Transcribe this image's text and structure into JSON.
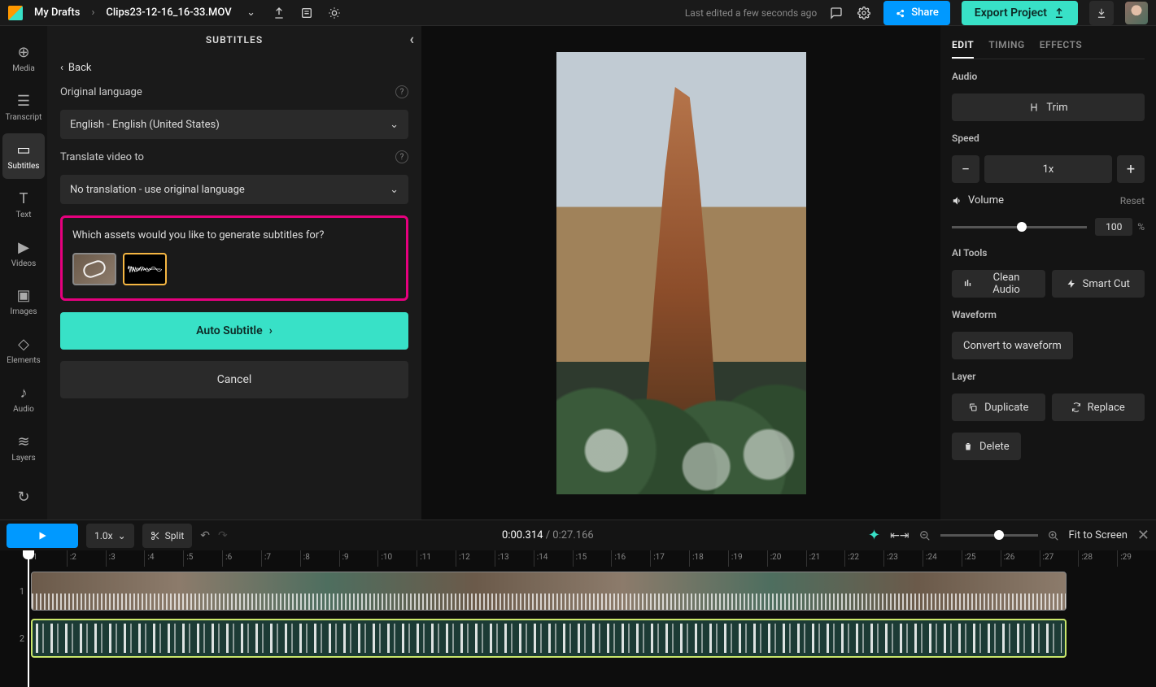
{
  "header": {
    "breadcrumb_root": "My Drafts",
    "breadcrumb_file": "Clips23-12-16_16-33.MOV",
    "status": "Last edited a few seconds ago",
    "share": "Share",
    "export": "Export Project"
  },
  "leftnav": {
    "media": "Media",
    "transcript": "Transcript",
    "subtitles": "Subtitles",
    "text": "Text",
    "videos": "Videos",
    "images": "Images",
    "elements": "Elements",
    "audio": "Audio",
    "layers": "Layers"
  },
  "panel": {
    "title": "SUBTITLES",
    "back": "Back",
    "orig_lang_label": "Original language",
    "orig_lang_value": "English - English (United States)",
    "translate_label": "Translate video to",
    "translate_value": "No translation - use original language",
    "assets_prompt": "Which assets would you like to generate subtitles for?",
    "auto_btn": "Auto Subtitle",
    "cancel_btn": "Cancel"
  },
  "right": {
    "tabs": {
      "edit": "EDIT",
      "timing": "TIMING",
      "effects": "EFFECTS"
    },
    "audio_label": "Audio",
    "trim": "Trim",
    "speed_label": "Speed",
    "speed_value": "1x",
    "volume": "Volume",
    "reset": "Reset",
    "volume_value": "100",
    "volume_unit": "%",
    "ai_label": "AI Tools",
    "clean": "Clean Audio",
    "smart": "Smart Cut",
    "wave_label": "Waveform",
    "convert": "Convert to waveform",
    "layer_label": "Layer",
    "duplicate": "Duplicate",
    "replace": "Replace",
    "delete": "Delete"
  },
  "toolbar": {
    "speed": "1.0x",
    "split": "Split",
    "time_current": "0:00.314",
    "time_total": "0:27.166",
    "fit": "Fit to Screen"
  },
  "timeline": {
    "ticks": [
      ":1",
      ":2",
      ":3",
      ":4",
      ":5",
      ":6",
      ":7",
      ":8",
      ":9",
      ":10",
      ":11",
      ":12",
      ":13",
      ":14",
      ":15",
      ":16",
      ":17",
      ":18",
      ":19",
      ":20",
      ":21",
      ":22",
      ":23",
      ":24",
      ":25",
      ":26",
      ":27",
      ":28",
      ":29"
    ],
    "track1": "1",
    "track2": "2"
  }
}
